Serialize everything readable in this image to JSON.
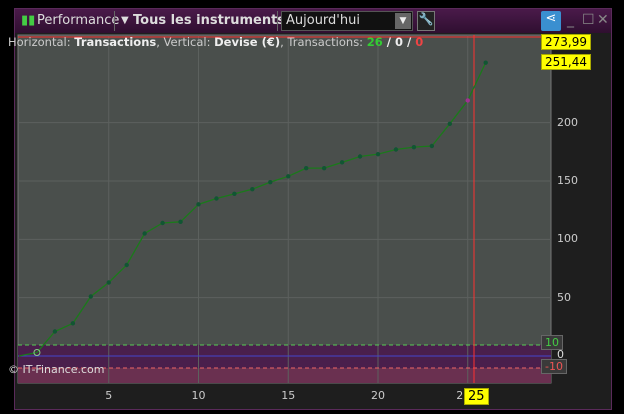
{
  "title": "Performance",
  "instruments": "Tous les instruments",
  "period": "Aujourd'hui",
  "info": {
    "h_label": "Horizontal: ",
    "h_value": "Transactions",
    "v_label": ", Vertical: ",
    "v_value": "Devise (€)",
    "t_label": ", Transactions: ",
    "wins": "26",
    "sep1": " / ",
    "neutral": "0",
    "sep2": " / ",
    "losses": "0"
  },
  "copyright": "© IT-Finance.com",
  "colors": {
    "line": "#1a7a1a",
    "up": "#3c3",
    "down": "#e44",
    "cursor": "#ff3030"
  },
  "icons": [
    "candlestick-icon",
    "chevron-down-icon",
    "wrench-icon",
    "share-icon",
    "minimize-icon",
    "maximize-icon",
    "close-icon"
  ],
  "chart_data": {
    "type": "line",
    "x": [
      0,
      1,
      2,
      3,
      4,
      5,
      6,
      7,
      8,
      9,
      10,
      11,
      12,
      13,
      14,
      15,
      16,
      17,
      18,
      19,
      20,
      21,
      22,
      23,
      24,
      25,
      26
    ],
    "values": [
      0,
      3,
      21,
      28,
      51,
      63,
      78,
      105,
      114,
      115,
      130,
      135,
      139,
      143,
      149,
      154,
      161,
      161,
      166,
      171,
      173,
      177,
      179,
      180,
      199,
      219,
      251.44
    ],
    "xlim": [
      0,
      30
    ],
    "ylim": [
      -23,
      275
    ],
    "xticks": [
      "5",
      "10",
      "15",
      "20",
      "2"
    ],
    "xtickvals": [
      5,
      10,
      15,
      20,
      25
    ],
    "yticks": [
      "50",
      "100",
      "150",
      "200"
    ],
    "ytickvals": [
      50,
      100,
      150,
      200
    ],
    "top_value": "273,99",
    "last_value": "251,44",
    "cursor_x": "25",
    "band_upper": "10",
    "band_zero": "0",
    "band_lower": "-10",
    "grid": true
  }
}
